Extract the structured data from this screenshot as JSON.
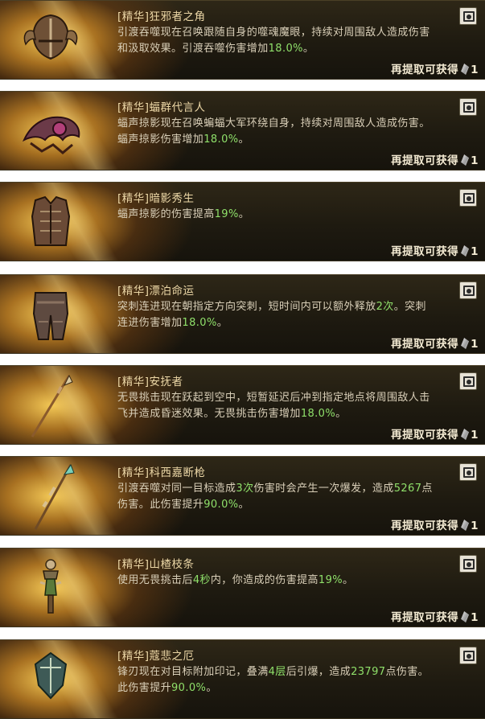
{
  "reward_label": "再提取可获得",
  "reward_count": "1",
  "cards": [
    {
      "title": "[精华]狂邪者之角",
      "icon": "horned-helm-icon",
      "d": [
        "引渡吞噬现在召唤跟随自身的噬魂魔眼，持续对周围敌人造成伤害",
        "和汲取效果。引渡吞噬伤害增加",
        "18.0%",
        "。"
      ]
    },
    {
      "title": "[精华]蝠群代言人",
      "icon": "winged-pauldron-icon",
      "d": [
        "蝠声掠影现在召唤蝙蝠大军环绕自身，持续对周围敌人造成伤害。",
        "蝠声掠影伤害增加",
        "18.0%",
        "。"
      ]
    },
    {
      "title": "[精华]暗影秀生",
      "icon": "chest-armor-icon",
      "d": [
        "蝠声掠影的伤害提高",
        "19%",
        "。"
      ]
    },
    {
      "title": "[精华]漂泊命运",
      "icon": "leg-armor-icon",
      "d": [
        "突刺连进现在朝指定方向突刺，短时间内可以额外释放",
        "2次",
        "。突刺",
        "连进伤害增加",
        "18.0%",
        "。"
      ]
    },
    {
      "title": "[精华]安抚者",
      "icon": "polearm-icon",
      "d": [
        "无畏挑击现在跃起到空中，短暂延迟后冲到指定地点将周围敌人击",
        "飞并造成昏迷效果。无畏挑击伤害增加",
        "18.0%",
        "。"
      ]
    },
    {
      "title": "[精华]科西嘉断枪",
      "icon": "spear-icon",
      "d": [
        "引渡吞噬对同一目标造成",
        "3次",
        "伤害时会产生一次爆发，造成",
        "5267",
        "点",
        "伤害。此伤害提升",
        "90.0%",
        "。"
      ]
    },
    {
      "title": "[精华]山楂枝条",
      "icon": "totem-icon",
      "d": [
        "使用无畏挑击后",
        "4秒",
        "内，你造成的伤害提高",
        "19%",
        "。"
      ]
    },
    {
      "title": "[精华]蔻悲之厄",
      "icon": "shield-icon",
      "d": [
        "锋刃现在对目标附加印记，叠满",
        "4层",
        "后引爆，造成",
        "23797",
        "点伤害。",
        "此伤害提升",
        "90.0%",
        "。"
      ]
    }
  ]
}
